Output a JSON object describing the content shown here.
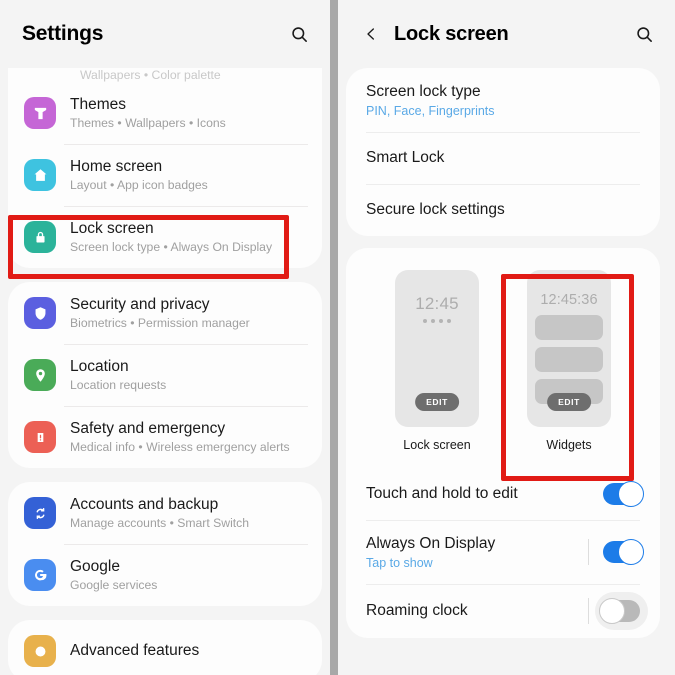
{
  "left_panel": {
    "header": {
      "title": "Settings",
      "search_icon": "search-icon"
    },
    "clipped_top_subtitle": "Wallpapers  •  Color palette",
    "groups": [
      {
        "id": "personalization",
        "items": [
          {
            "title": "Themes",
            "subtitle": "Themes  •  Wallpapers  •  Icons",
            "icon": "themes-icon",
            "icon_color": "#c566d6",
            "highlighted": false
          },
          {
            "title": "Home screen",
            "subtitle": "Layout  •  App icon badges",
            "icon": "home-icon",
            "icon_color": "#3ec3e0",
            "highlighted": false
          },
          {
            "title": "Lock screen",
            "subtitle": "Screen lock type  •  Always On Display",
            "icon": "lock-icon",
            "icon_color": "#2bb39a",
            "highlighted": true
          }
        ]
      },
      {
        "id": "security",
        "items": [
          {
            "title": "Security and privacy",
            "subtitle": "Biometrics  •  Permission manager",
            "icon": "shield-icon",
            "icon_color": "#5b5fe0",
            "highlighted": false
          },
          {
            "title": "Location",
            "subtitle": "Location requests",
            "icon": "location-pin-icon",
            "icon_color": "#4aab58",
            "highlighted": false
          },
          {
            "title": "Safety and emergency",
            "subtitle": "Medical info  •  Wireless emergency alerts",
            "icon": "emergency-alert-icon",
            "icon_color": "#ec6055",
            "highlighted": false
          }
        ]
      },
      {
        "id": "accounts",
        "items": [
          {
            "title": "Accounts and backup",
            "subtitle": "Manage accounts  •  Smart Switch",
            "icon": "sync-icon",
            "icon_color": "#3461d6",
            "highlighted": false
          },
          {
            "title": "Google",
            "subtitle": "Google services",
            "icon": "google-g-icon",
            "icon_color": "#4a8df0",
            "highlighted": false
          }
        ]
      },
      {
        "id": "advanced-clipped",
        "items": [
          {
            "title": "Advanced features",
            "subtitle": "",
            "icon": "advanced-features-icon",
            "icon_color": "#e8b14c",
            "highlighted": false
          }
        ]
      }
    ]
  },
  "right_panel": {
    "header": {
      "back_icon": "back-chevron-icon",
      "title": "Lock screen",
      "search_icon": "search-icon"
    },
    "lock_card": [
      {
        "title": "Screen lock type",
        "sub_link": "PIN, Face, Fingerprints"
      },
      {
        "title": "Smart Lock",
        "sub_link": ""
      },
      {
        "title": "Secure lock settings",
        "sub_link": ""
      }
    ],
    "previews": [
      {
        "id": "lock-screen-preview",
        "label": "Lock screen",
        "clock": "12:45",
        "dots": 4,
        "bars": 0,
        "edit_label": "EDIT",
        "highlighted": false
      },
      {
        "id": "widgets-preview",
        "label": "Widgets",
        "clock": "12:45:36",
        "dots": 0,
        "bars": 3,
        "edit_label": "EDIT",
        "highlighted": true
      }
    ],
    "toggle_rows": [
      {
        "title": "Touch and hold to edit",
        "sub_link": "",
        "state": "on",
        "divider": false
      },
      {
        "title": "Always On Display",
        "sub_link": "Tap to show",
        "state": "on",
        "divider": true
      },
      {
        "title": "Roaming clock",
        "sub_link": "",
        "state": "off",
        "divider": true
      }
    ]
  },
  "colors": {
    "highlight_red": "#e11b15",
    "toggle_on": "#1d7ce8",
    "toggle_off": "#b9b9b9",
    "link_blue": "#5aa9e6",
    "page_background": "#f4f4f4",
    "card_background": "#fdfdfd"
  }
}
